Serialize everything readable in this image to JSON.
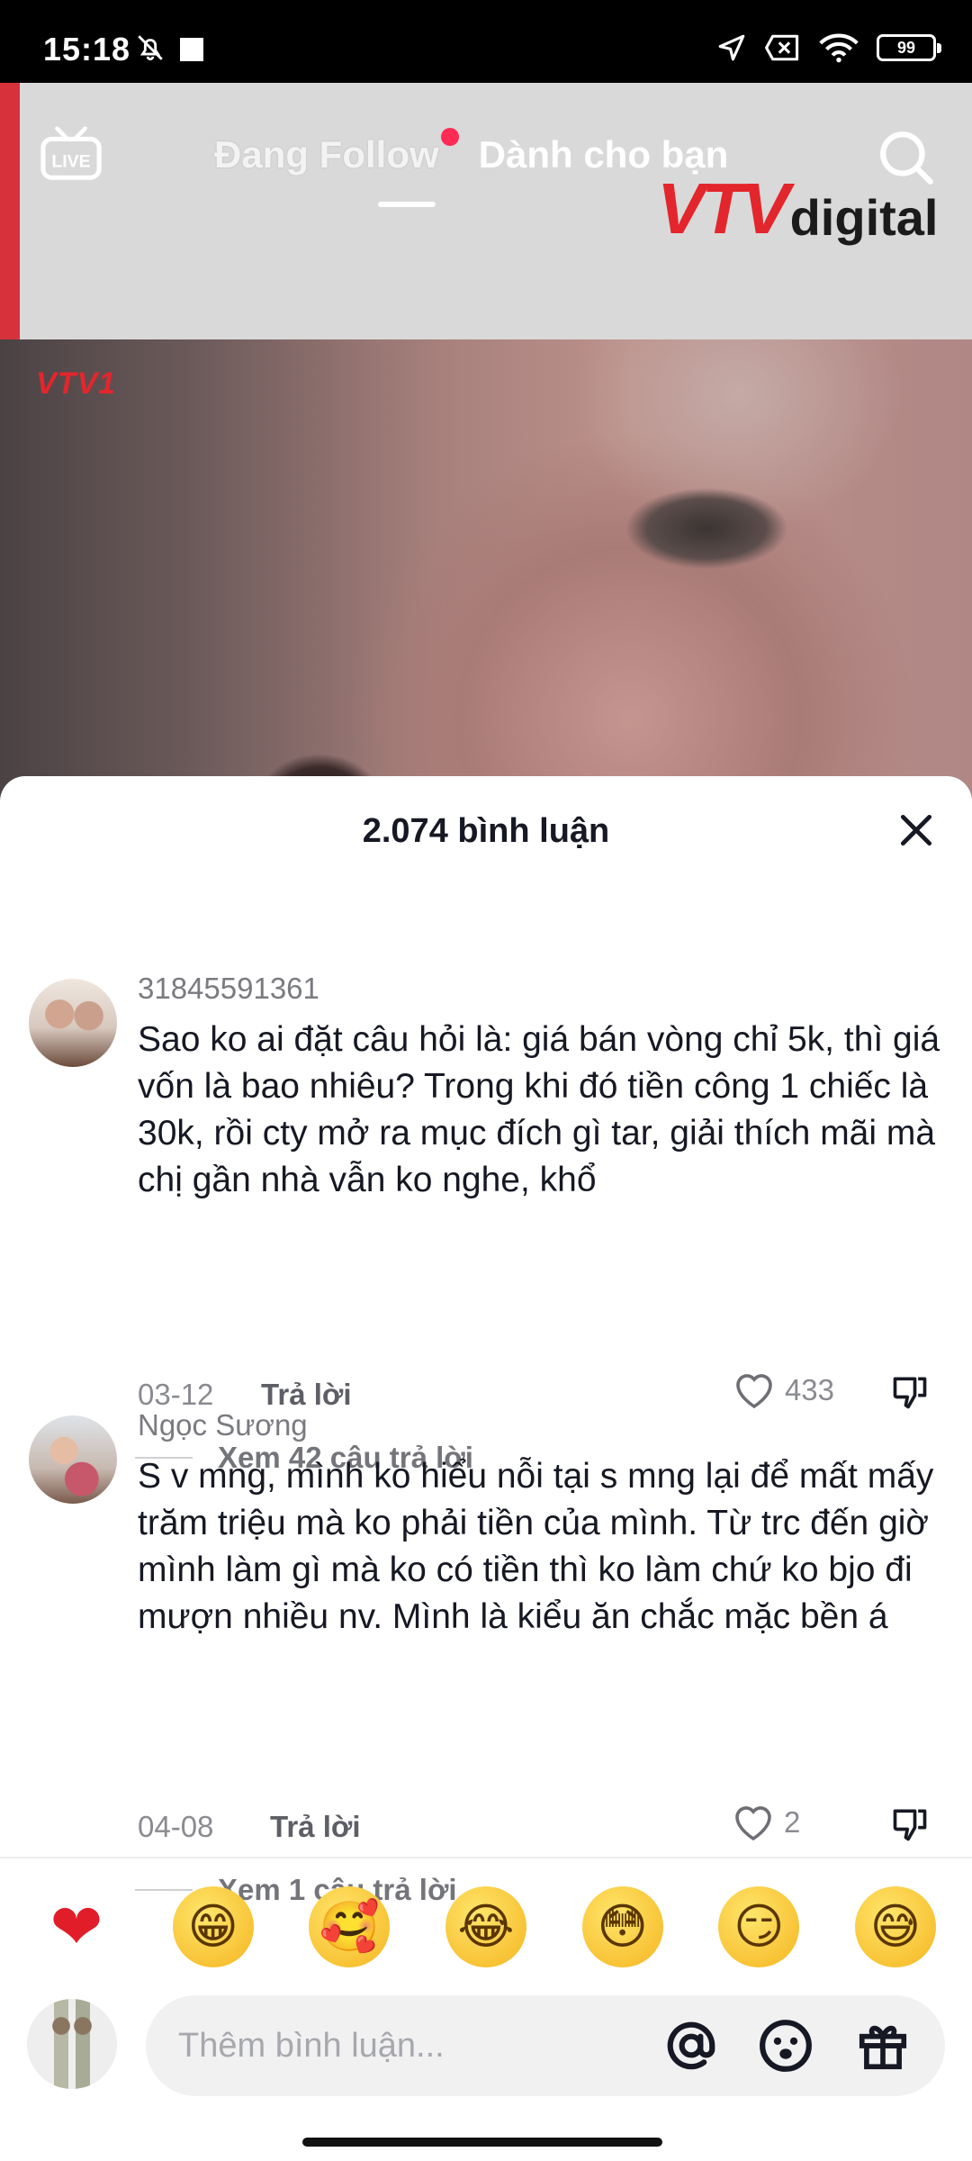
{
  "status_bar": {
    "time": "15:18",
    "battery": "99",
    "icons": [
      "bell-off-icon",
      "square-icon",
      "location-arrow-icon",
      "x-box-icon",
      "wifi-icon",
      "battery-icon"
    ]
  },
  "top_nav": {
    "live_label": "LIVE",
    "tab_following": "Đang Follow",
    "tab_for_you": "Dành cho bạn",
    "has_following_dot": true
  },
  "video": {
    "channel_logo": "VTV1",
    "brand_vtv": "VTV",
    "brand_digital": "digital"
  },
  "comments_sheet": {
    "title": "2.074 bình luận",
    "comments": [
      {
        "username": "31845591361",
        "text": "Sao ko ai đặt câu hỏi là: giá bán vòng chỉ 5k, thì giá vốn là bao nhiêu? Trong khi đó tiền công 1 chiếc là 30k, rồi cty mở ra mục đích gì tar, giải thích mãi mà chị gần nhà vẫn ko nghe, khổ",
        "date": "03-12",
        "reply_label": "Trả lời",
        "likes": "433",
        "view_replies": "Xem 42 câu trả lời"
      },
      {
        "username": "Ngọc Sương",
        "text": "S v mng, mình ko hiểu nỗi tại s mng lại để mất mấy trăm triệu mà ko phải tiền của mình. Từ trc đến giờ mình làm gì mà ko có tiền thì ko làm chứ ko bjo đi mượn nhiều nv. Mình là kiểu ăn chắc mặc bền á",
        "date": "04-08",
        "reply_label": "Trả lời",
        "likes": "2",
        "view_replies": "Xem 1 câu trả lời"
      }
    ]
  },
  "emoji_bar": {
    "emojis": [
      "❤",
      "😁",
      "🥰",
      "😂",
      "😳",
      "😏",
      "😅"
    ]
  },
  "comment_input": {
    "placeholder": "Thêm bình luận..."
  },
  "colors": {
    "accent_red": "#ff2b55",
    "vtv_red": "#e3262c",
    "vtv_blue": "#1f3f99",
    "text_primary": "#161823",
    "text_secondary": "#7a7b80"
  }
}
